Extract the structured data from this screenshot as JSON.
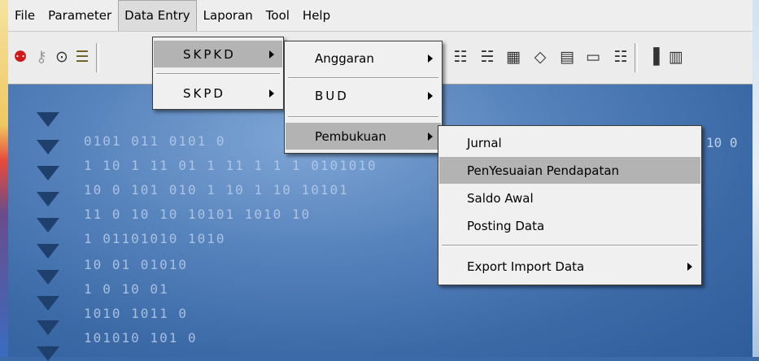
{
  "menubar": {
    "items": [
      {
        "label": "File"
      },
      {
        "label": "Parameter"
      },
      {
        "label": "Data Entry"
      },
      {
        "label": "Laporan"
      },
      {
        "label": "Tool"
      },
      {
        "label": "Help"
      }
    ]
  },
  "data_entry_menu": {
    "items": [
      {
        "label": "SKPKD"
      },
      {
        "label": "SKPD"
      }
    ]
  },
  "skpkd_menu": {
    "items": [
      {
        "label": "Anggaran"
      },
      {
        "label": "BUD"
      },
      {
        "label": "Pembukuan"
      }
    ]
  },
  "pembukuan_menu": {
    "items": [
      {
        "label": "Jurnal"
      },
      {
        "label": "PenYesuaian Pendapatan"
      },
      {
        "label": "Saldo Awal"
      },
      {
        "label": "Posting Data"
      },
      {
        "label": "Export Import Data"
      }
    ]
  },
  "background": {
    "binary_lines": [
      "0101 011  0101 0",
      "1 10 1 11 01 1  11 1 1 1  0101010",
      "10 0 101 010 1 10   1 10 10101",
      "11 0 10    10 10101    1010  10",
      "1 01101010    1010",
      "10 01 01010",
      "1 0 10 01",
      "1010 1011 0",
      "101010 101 0"
    ],
    "right_bits": "10  0"
  },
  "colors": {
    "menu_bg": "#f0f0f0",
    "highlight": "#b3b3b3",
    "workspace": "#3b6aa7"
  }
}
